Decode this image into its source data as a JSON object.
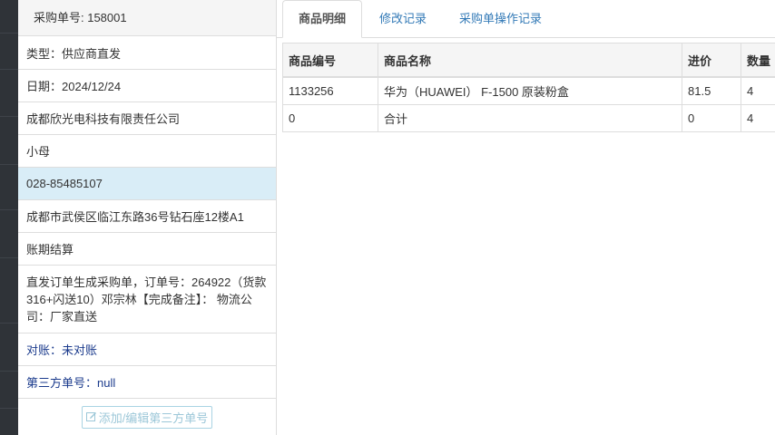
{
  "header": {
    "order_label": "采购单号: 158001"
  },
  "info": {
    "type": "类型：供应商直发",
    "date": "日期：2024/12/24",
    "company": "成都欣光电科技有限责任公司",
    "contact": "小母",
    "phone": "028-85485107",
    "address": "成都市武侯区临江东路36号钻石座12楼A1",
    "payment": "账期结算",
    "remark": "直发订单生成采购单，订单号：264922（货款316+闪送10）邓宗林【完成备注】： 物流公司：厂家直送",
    "reconcile": "对账：未对账",
    "third_party_no": "第三方单号：null",
    "edit_button": "添加/编辑第三方单号"
  },
  "tabs": [
    {
      "label": "商品明细",
      "active": true
    },
    {
      "label": "修改记录",
      "active": false
    },
    {
      "label": "采购单操作记录",
      "active": false
    }
  ],
  "table": {
    "columns": [
      "商品编号",
      "商品名称",
      "进价",
      "数量"
    ],
    "rows": [
      [
        "1133256",
        "华为（HUAWEI） F-1500 原装粉盒",
        "81.5",
        "4"
      ],
      [
        "0",
        "合计",
        "0",
        "4"
      ]
    ]
  },
  "colors": {
    "active_row": "#d9edf7",
    "link": "#337ab7",
    "sidebar": "#2f3338"
  }
}
